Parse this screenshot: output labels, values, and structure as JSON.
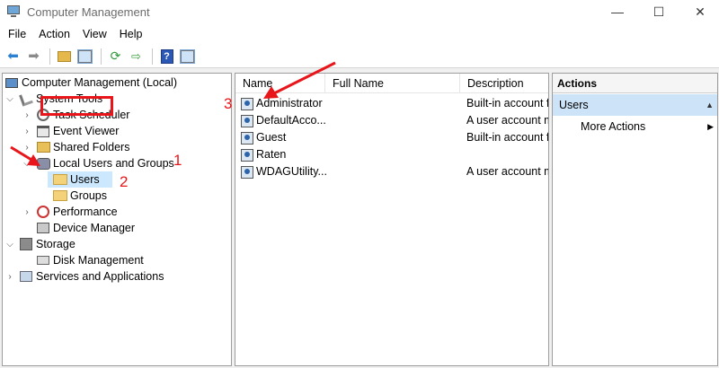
{
  "window": {
    "title": "Computer Management"
  },
  "window_controls": {
    "minimize": "—",
    "maximize": "☐",
    "close": "✕"
  },
  "menu": [
    "File",
    "Action",
    "View",
    "Help"
  ],
  "tree": {
    "root": "Computer Management (Local)",
    "items": [
      {
        "label": "System Tools"
      },
      {
        "label": "Task Scheduler"
      },
      {
        "label": "Event Viewer"
      },
      {
        "label": "Shared Folders"
      },
      {
        "label": "Local Users and Groups"
      },
      {
        "label": "Users"
      },
      {
        "label": "Groups"
      },
      {
        "label": "Performance"
      },
      {
        "label": "Device Manager"
      },
      {
        "label": "Storage"
      },
      {
        "label": "Disk Management"
      },
      {
        "label": "Services and Applications"
      }
    ]
  },
  "list": {
    "columns": [
      "Name",
      "Full Name",
      "Description"
    ],
    "rows": [
      {
        "name": "Administrator",
        "full_name": "",
        "description": "Built-in account f"
      },
      {
        "name": "DefaultAcco...",
        "full_name": "",
        "description": "A user account m"
      },
      {
        "name": "Guest",
        "full_name": "",
        "description": "Built-in account f"
      },
      {
        "name": "Raten",
        "full_name": "",
        "description": ""
      },
      {
        "name": "WDAGUtility...",
        "full_name": "",
        "description": "A user account m"
      }
    ]
  },
  "actions": {
    "header": "Actions",
    "section": "Users",
    "items": [
      "More Actions"
    ]
  },
  "annotations": {
    "step1": "1",
    "step2": "2",
    "step3": "3",
    "color": "#e8161b"
  }
}
